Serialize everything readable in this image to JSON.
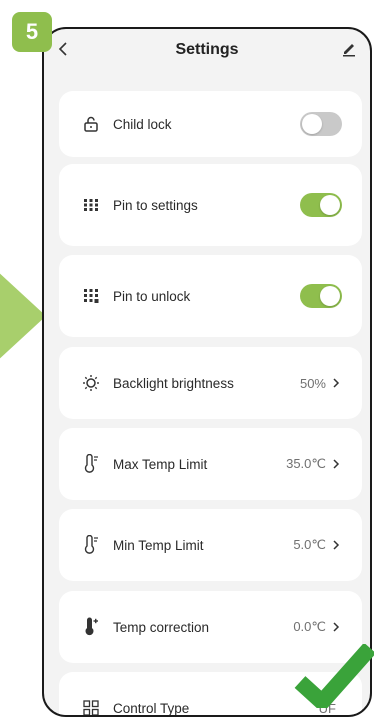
{
  "step_badge": "5",
  "header": {
    "title": "Settings"
  },
  "items": [
    {
      "label": "Child lock",
      "toggle": "off"
    },
    {
      "label": "Pin to settings",
      "toggle": "on"
    },
    {
      "label": "Pin to unlock",
      "toggle": "on"
    },
    {
      "label": "Backlight brightness",
      "value": "50%"
    },
    {
      "label": "Max Temp Limit",
      "value": "35.0℃"
    },
    {
      "label": "Min Temp Limit",
      "value": "5.0℃"
    },
    {
      "label": "Temp correction",
      "value": "0.0℃"
    },
    {
      "label": "Control Type",
      "value": "UF"
    }
  ],
  "colors": {
    "accent": "#8fbe4d",
    "toggle_off": "#c9c9c9",
    "background": "#f3f3f3"
  },
  "icons": [
    "back-icon",
    "edit-icon",
    "lock-icon",
    "keypad-icon",
    "keypad-icon",
    "brightness-icon",
    "thermometer-icon",
    "thermometer-icon",
    "temp-correction-icon",
    "grid-icon",
    "chevron-right-icon",
    "checkmark-icon"
  ]
}
